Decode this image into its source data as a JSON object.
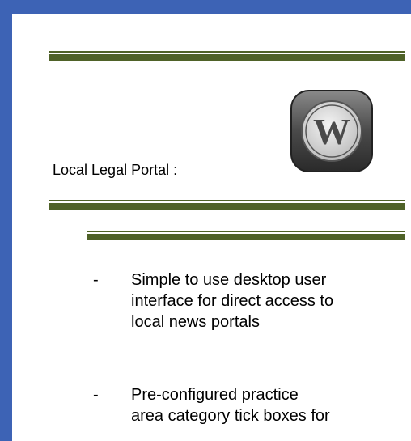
{
  "heading": {
    "label": "Local Legal Portal :"
  },
  "logo": {
    "icon": "wordpress-icon",
    "letter": "W"
  },
  "bullets": [
    {
      "marker": "-",
      "lines": [
        "Simple to use desktop user",
        "interface for direct access to",
        "local news portals"
      ]
    },
    {
      "marker": "-",
      "lines": [
        "Pre-configured practice",
        "area category tick boxes for"
      ]
    }
  ],
  "colors": {
    "frame": "#3d63b5",
    "rule": "#4f6228"
  }
}
